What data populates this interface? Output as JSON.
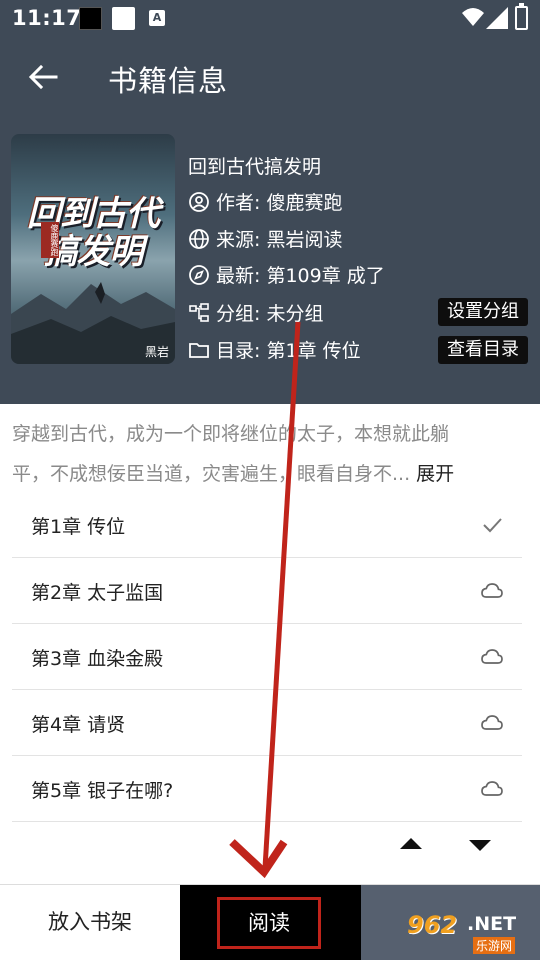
{
  "status_bar": {
    "time": "11:17",
    "notification_icon": "A"
  },
  "header": {
    "title": "书籍信息"
  },
  "book": {
    "cover": {
      "title_line1": "回到古代",
      "title_line2": "搞发明",
      "author_tag": "傻鹿赛跑",
      "publisher": "黑岩"
    },
    "name": "回到古代搞发明",
    "author": "作者: 傻鹿赛跑",
    "source": "来源: 黑岩阅读",
    "latest": "最新: 第109章 成了",
    "group": "分组: 未分组",
    "toc": "目录: 第1章 传位"
  },
  "actions": {
    "set_group": "设置分组",
    "view_toc": "查看目录"
  },
  "description": {
    "line1": "穿越到古代，成为一个即将继位的太子，本想就此躺",
    "line2": "平，不成想佞臣当道，灾害遍生，眼看自身不...",
    "expand": "展开"
  },
  "chapters": [
    {
      "label": "第1章 传位",
      "status_icon": "check-icon"
    },
    {
      "label": "第2章 太子监国",
      "status_icon": "cloud-icon"
    },
    {
      "label": "第3章 血染金殿",
      "status_icon": "cloud-icon"
    },
    {
      "label": "第4章 请贤",
      "status_icon": "cloud-icon"
    },
    {
      "label": "第5章 银子在哪?",
      "status_icon": "cloud-icon"
    }
  ],
  "bottom_bar": {
    "add_to_shelf": "放入书架",
    "read": "阅读"
  },
  "watermark": {
    "number": "962",
    "net": ".NET",
    "site": "乐游网"
  },
  "colors": {
    "header_bg": "#3f4a57",
    "annotation_red": "#c0241b"
  }
}
